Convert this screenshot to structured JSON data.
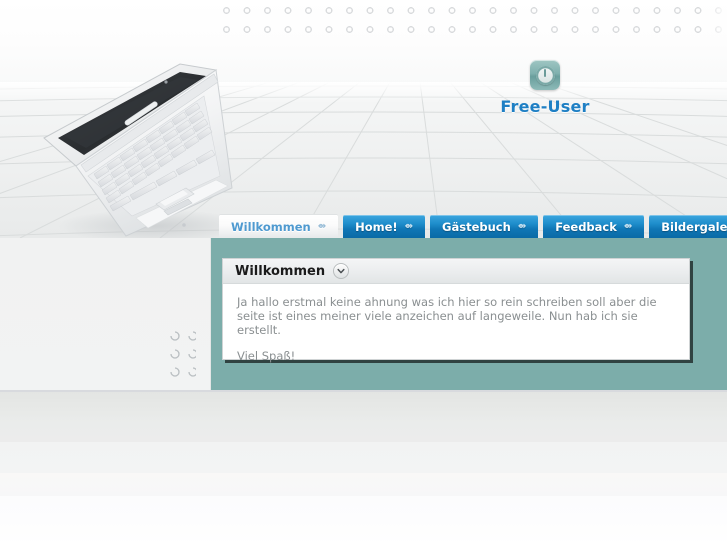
{
  "site": {
    "brand_name": "Free-User",
    "logo_icon": "power-button-icon"
  },
  "nav": {
    "arrow_icon": "arrow-right-small-icon",
    "tabs": [
      {
        "label": "Willkommen",
        "active": true
      },
      {
        "label": "Home!",
        "active": false
      },
      {
        "label": "Gästebuch",
        "active": false
      },
      {
        "label": "Feedback",
        "active": false
      },
      {
        "label": "Bildergalerie",
        "active": false
      }
    ]
  },
  "content": {
    "card_title": "Willkommen",
    "collapse_icon": "chevron-down-icon",
    "paragraph_1": "Ja hallo erstmal keine ahnung was ich hier so rein schreiben soll aber die seite ist eines meiner viele anzeichen auf langeweile. Nun hab ich sie erstellt.",
    "paragraph_2": "Viel Spaß!"
  },
  "decor": {
    "laptop_icon": "laptop-illustration",
    "dots_pattern_icon": "crescent-dot-pattern"
  },
  "colors": {
    "accent_blue": "#1e7fc4",
    "tab_blue": "#0f76b5",
    "panel_teal": "#7cadaa",
    "card_white": "#ffffff",
    "body_text": "#8a8f91"
  }
}
